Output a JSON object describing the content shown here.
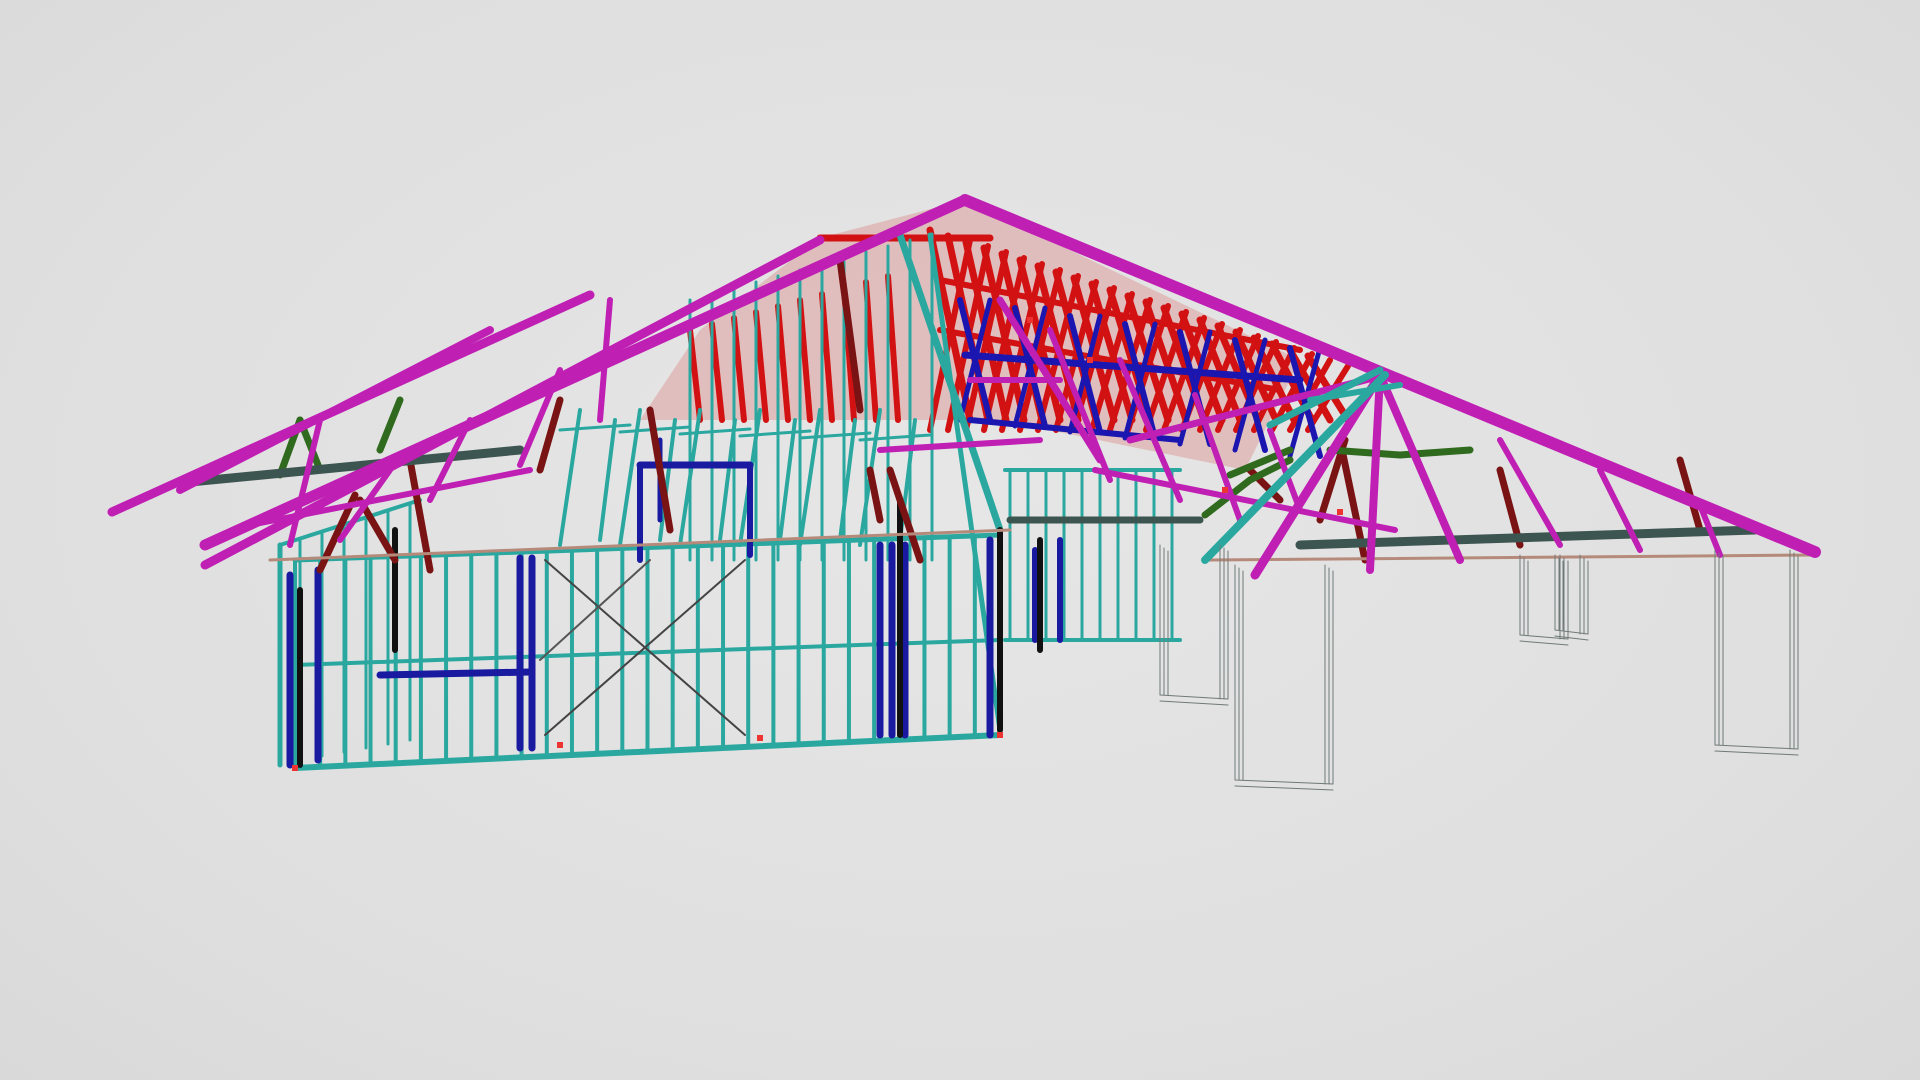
{
  "scene": {
    "description_hidden": false,
    "model_name": "",
    "background_color": "#e0e0e0"
  },
  "colors": {
    "roof_top_chord": "#c01fb4",
    "roof_web_red": "#d21212",
    "roof_web_dark_red": "#7a1414",
    "roof_web_blue": "#1b16b0",
    "roof_web_green": "#2f6a1e",
    "wall_stud_teal": "#2aa8a0",
    "wall_stud_blue": "#1a1aa0",
    "wall_black": "#111111",
    "beam_dark": "#3d5550",
    "post_wire": "#6f7a78",
    "fascia_line": "#c88a6a"
  }
}
